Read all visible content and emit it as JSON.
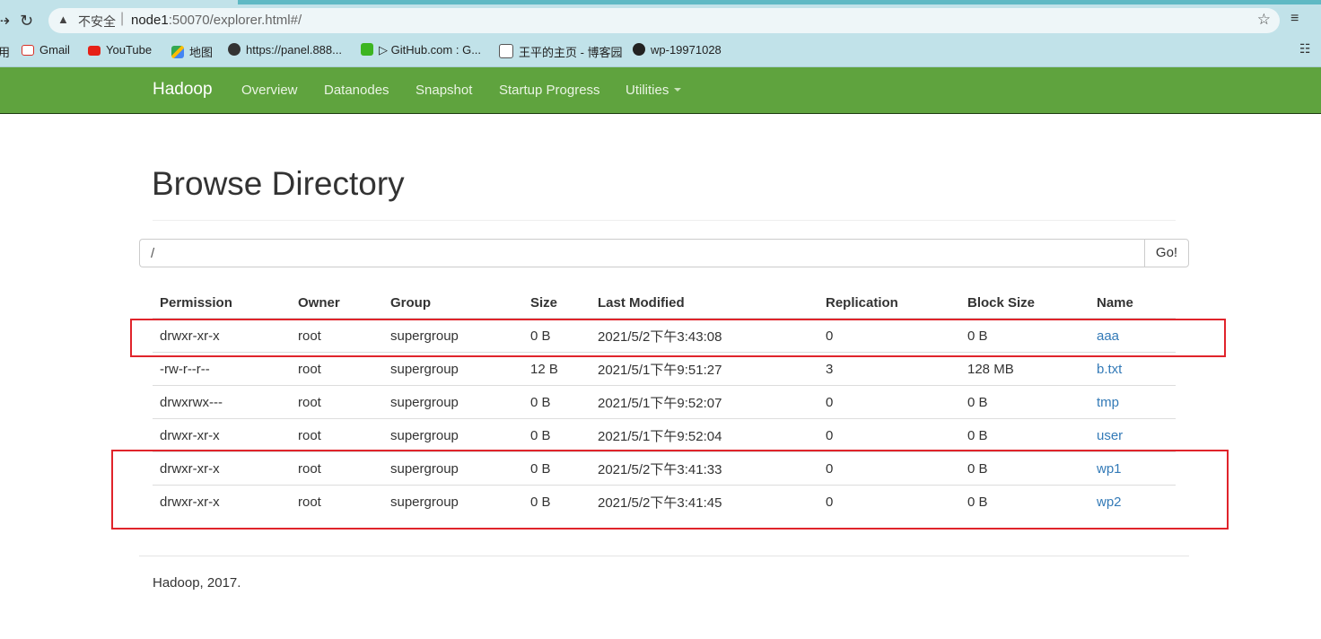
{
  "browser": {
    "address": {
      "insecure_label": "不安全",
      "url_host": "node1",
      "url_rest": ":50070/explorer.html#/"
    },
    "bookmarks": [
      {
        "label": "用",
        "icon": "apps-icon"
      },
      {
        "label": "Gmail",
        "icon": "gmail-icon"
      },
      {
        "label": "YouTube",
        "icon": "youtube-icon"
      },
      {
        "label": "地图",
        "icon": "maps-icon"
      },
      {
        "label": "https://panel.888...",
        "icon": "globe-icon"
      },
      {
        "label": "▷ GitHub.com : G...",
        "icon": "github-mirror-icon"
      },
      {
        "label": "王平的主页 - 博客园",
        "icon": "cnblogs-icon"
      },
      {
        "label": "wp-19971028",
        "icon": "github-icon"
      }
    ]
  },
  "navbar": {
    "brand": "Hadoop",
    "links": [
      "Overview",
      "Datanodes",
      "Snapshot",
      "Startup Progress",
      "Utilities"
    ]
  },
  "page": {
    "title": "Browse Directory",
    "path_value": "/",
    "go_label": "Go!"
  },
  "table": {
    "headers": [
      "Permission",
      "Owner",
      "Group",
      "Size",
      "Last Modified",
      "Replication",
      "Block Size",
      "Name"
    ],
    "rows": [
      [
        "drwxr-xr-x",
        "root",
        "supergroup",
        "0 B",
        "2021/5/2下午3:43:08",
        "0",
        "0 B",
        "aaa"
      ],
      [
        "-rw-r--r--",
        "root",
        "supergroup",
        "12 B",
        "2021/5/1下午9:51:27",
        "3",
        "128 MB",
        "b.txt"
      ],
      [
        "drwxrwx---",
        "root",
        "supergroup",
        "0 B",
        "2021/5/1下午9:52:07",
        "0",
        "0 B",
        "tmp"
      ],
      [
        "drwxr-xr-x",
        "root",
        "supergroup",
        "0 B",
        "2021/5/1下午9:52:04",
        "0",
        "0 B",
        "user"
      ],
      [
        "drwxr-xr-x",
        "root",
        "supergroup",
        "0 B",
        "2021/5/2下午3:41:33",
        "0",
        "0 B",
        "wp1"
      ],
      [
        "drwxr-xr-x",
        "root",
        "supergroup",
        "0 B",
        "2021/5/2下午3:41:45",
        "0",
        "0 B",
        "wp2"
      ]
    ]
  },
  "footer": {
    "text": "Hadoop, 2017."
  },
  "colors": {
    "navbar": "#5fa33e",
    "link": "#337ab7",
    "highlight": "#e0242b"
  }
}
